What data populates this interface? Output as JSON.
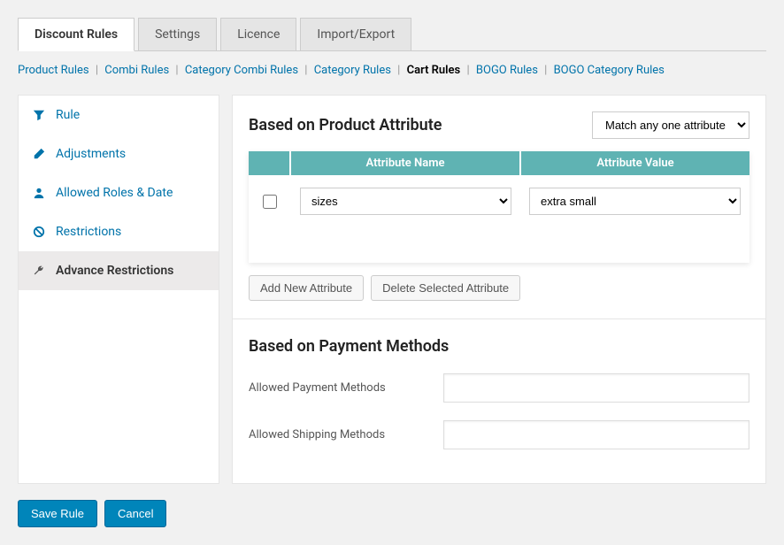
{
  "tabs": [
    {
      "label": "Discount Rules",
      "active": true
    },
    {
      "label": "Settings",
      "active": false
    },
    {
      "label": "Licence",
      "active": false
    },
    {
      "label": "Import/Export",
      "active": false
    }
  ],
  "subnav": [
    {
      "label": "Product Rules",
      "current": false
    },
    {
      "label": "Combi Rules",
      "current": false
    },
    {
      "label": "Category Combi Rules",
      "current": false
    },
    {
      "label": "Category Rules",
      "current": false
    },
    {
      "label": "Cart Rules",
      "current": true
    },
    {
      "label": "BOGO Rules",
      "current": false
    },
    {
      "label": "BOGO Category Rules",
      "current": false
    }
  ],
  "sidebar": [
    {
      "label": "Rule",
      "icon": "filter-icon",
      "active": false
    },
    {
      "label": "Adjustments",
      "icon": "pencil-icon",
      "active": false
    },
    {
      "label": "Allowed Roles & Date",
      "icon": "user-icon",
      "active": false
    },
    {
      "label": "Restrictions",
      "icon": "ban-icon",
      "active": false
    },
    {
      "label": "Advance Restrictions",
      "icon": "wrench-icon",
      "active": true
    }
  ],
  "attribute_section": {
    "title": "Based on Product Attribute",
    "match_select": "Match any one attribute",
    "col_name": "Attribute Name",
    "col_value": "Attribute Value",
    "rows": [
      {
        "name": "sizes",
        "value": "extra small"
      }
    ],
    "add_btn": "Add New Attribute",
    "delete_btn": "Delete Selected Attribute"
  },
  "payment_section": {
    "title": "Based on Payment Methods",
    "allowed_payment_label": "Allowed Payment Methods",
    "allowed_payment_value": "",
    "allowed_shipping_label": "Allowed Shipping Methods",
    "allowed_shipping_value": ""
  },
  "footer": {
    "save": "Save Rule",
    "cancel": "Cancel"
  }
}
